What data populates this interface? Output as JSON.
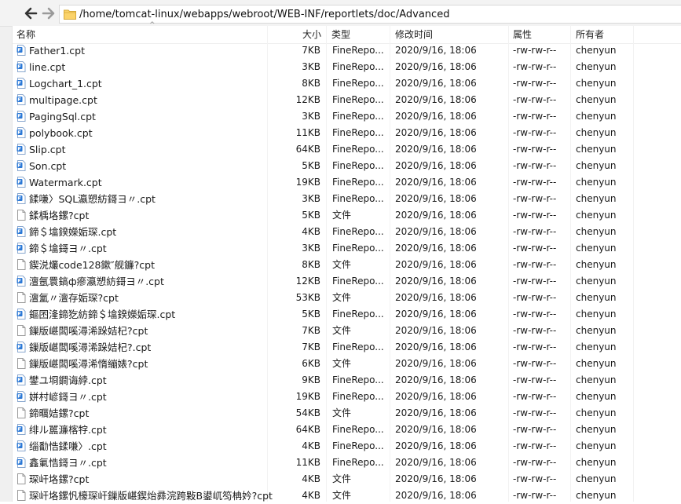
{
  "path": "/home/tomcat-linux/webapps/webroot/WEB-INF/reportlets/doc/Advanced",
  "columns": {
    "name": "名称",
    "size": "大小",
    "type": "类型",
    "mtime": "修改时间",
    "perm": "属性",
    "owner": "所有者"
  },
  "sort_indicator": "^",
  "files": [
    {
      "name": "Father1.cpt",
      "size": "7KB",
      "type": "FineRepo...",
      "mtime": "2020/9/16, 18:06",
      "perm": "-rw-rw-r--",
      "owner": "chenyun",
      "icon": "finereport-file-icon"
    },
    {
      "name": "line.cpt",
      "size": "3KB",
      "type": "FineRepo...",
      "mtime": "2020/9/16, 18:06",
      "perm": "-rw-rw-r--",
      "owner": "chenyun",
      "icon": "finereport-file-icon"
    },
    {
      "name": "Logchart_1.cpt",
      "size": "8KB",
      "type": "FineRepo...",
      "mtime": "2020/9/16, 18:06",
      "perm": "-rw-rw-r--",
      "owner": "chenyun",
      "icon": "finereport-file-icon"
    },
    {
      "name": "multipage.cpt",
      "size": "12KB",
      "type": "FineRepo...",
      "mtime": "2020/9/16, 18:06",
      "perm": "-rw-rw-r--",
      "owner": "chenyun",
      "icon": "finereport-file-icon"
    },
    {
      "name": "PagingSql.cpt",
      "size": "3KB",
      "type": "FineRepo...",
      "mtime": "2020/9/16, 18:06",
      "perm": "-rw-rw-r--",
      "owner": "chenyun",
      "icon": "finereport-file-icon"
    },
    {
      "name": "polybook.cpt",
      "size": "11KB",
      "type": "FineRepo...",
      "mtime": "2020/9/16, 18:06",
      "perm": "-rw-rw-r--",
      "owner": "chenyun",
      "icon": "finereport-file-icon"
    },
    {
      "name": "Slip.cpt",
      "size": "64KB",
      "type": "FineRepo...",
      "mtime": "2020/9/16, 18:06",
      "perm": "-rw-rw-r--",
      "owner": "chenyun",
      "icon": "finereport-file-icon"
    },
    {
      "name": "Son.cpt",
      "size": "5KB",
      "type": "FineRepo...",
      "mtime": "2020/9/16, 18:06",
      "perm": "-rw-rw-r--",
      "owner": "chenyun",
      "icon": "finereport-file-icon"
    },
    {
      "name": "Watermark.cpt",
      "size": "19KB",
      "type": "FineRepo...",
      "mtime": "2020/9/16, 18:06",
      "perm": "-rw-rw-r--",
      "owner": "chenyun",
      "icon": "finereport-file-icon"
    },
    {
      "name": "鍒嗛〉SQL瀛愬紡鎶ヨ〃.cpt",
      "size": "3KB",
      "type": "FineRepo...",
      "mtime": "2020/9/16, 18:06",
      "perm": "-rw-rw-r--",
      "owner": "chenyun",
      "icon": "finereport-file-icon"
    },
    {
      "name": "鍒楀垎鏍?cpt",
      "size": "5KB",
      "type": "文件",
      "mtime": "2020/9/16, 18:06",
      "perm": "-rw-rw-r--",
      "owner": "chenyun",
      "icon": "generic-file-icon"
    },
    {
      "name": "鍗＄墖鍨嬫姤琛.cpt",
      "size": "4KB",
      "type": "FineRepo...",
      "mtime": "2020/9/16, 18:06",
      "perm": "-rw-rw-r--",
      "owner": "chenyun",
      "icon": "finereport-file-icon"
    },
    {
      "name": "鍗＄墖鎶ヨ〃.cpt",
      "size": "3KB",
      "type": "FineRepo...",
      "mtime": "2020/9/16, 18:06",
      "perm": "-rw-rw-r--",
      "owner": "chenyun",
      "icon": "finereport-file-icon"
    },
    {
      "name": "鍥涚爜code128鏉″舰鐮?cpt",
      "size": "8KB",
      "type": "文件",
      "mtime": "2020/9/16, 18:06",
      "perm": "-rw-rw-r--",
      "owner": "chenyun",
      "icon": "generic-file-icon"
    },
    {
      "name": "澶氬睘鎬ф瘮瀛愬紡鎶ヨ〃.cpt",
      "size": "12KB",
      "type": "FineRepo...",
      "mtime": "2020/9/16, 18:06",
      "perm": "-rw-rw-r--",
      "owner": "chenyun",
      "icon": "finereport-file-icon"
    },
    {
      "name": "澶氳〃澶存姤琛?cpt",
      "size": "53KB",
      "type": "文件",
      "mtime": "2020/9/16, 18:06",
      "perm": "-rw-rw-r--",
      "owner": "chenyun",
      "icon": "generic-file-icon"
    },
    {
      "name": "鏂囨湰鍗犵紡鍗＄墖鍨嬫姤琛.cpt",
      "size": "5KB",
      "type": "FineRepo...",
      "mtime": "2020/9/16, 18:06",
      "perm": "-rw-rw-r--",
      "owner": "chenyun",
      "icon": "finereport-file-icon"
    },
    {
      "name": "鏁版嵁闆嗘潯浠跺姞杞?cpt",
      "size": "7KB",
      "type": "文件",
      "mtime": "2020/9/16, 18:06",
      "perm": "-rw-rw-r--",
      "owner": "chenyun",
      "icon": "generic-file-icon"
    },
    {
      "name": "鏁版嵁闆嗘潯浠跺姞杞?.cpt",
      "size": "7KB",
      "type": "FineRepo...",
      "mtime": "2020/9/16, 18:06",
      "perm": "-rw-rw-r--",
      "owner": "chenyun",
      "icon": "finereport-file-icon"
    },
    {
      "name": "鏁版嵁闆嗘潯浠惰繃婊?cpt",
      "size": "6KB",
      "type": "文件",
      "mtime": "2020/9/16, 18:06",
      "perm": "-rw-rw-r--",
      "owner": "chenyun",
      "icon": "generic-file-icon"
    },
    {
      "name": "鐢ユ埛鐧诲綍.cpt",
      "size": "9KB",
      "type": "FineRepo...",
      "mtime": "2020/9/16, 18:06",
      "perm": "-rw-rw-r--",
      "owner": "chenyun",
      "icon": "finereport-file-icon"
    },
    {
      "name": "姘村嵃鎶ヨ〃.cpt",
      "size": "19KB",
      "type": "FineRepo...",
      "mtime": "2020/9/16, 18:06",
      "perm": "-rw-rw-r--",
      "owner": "chenyun",
      "icon": "finereport-file-icon"
    },
    {
      "name": "鍗曞姞鏍?cpt",
      "size": "54KB",
      "type": "文件",
      "mtime": "2020/9/16, 18:06",
      "perm": "-rw-rw-r--",
      "owner": "chenyun",
      "icon": "generic-file-icon"
    },
    {
      "name": "绯ル嚚濂楁牸.cpt",
      "size": "64KB",
      "type": "FineRepo...",
      "mtime": "2020/9/16, 18:06",
      "perm": "-rw-rw-r--",
      "owner": "chenyun",
      "icon": "finereport-file-icon"
    },
    {
      "name": "缁勫悎鍒嗛〉.cpt",
      "size": "4KB",
      "type": "FineRepo...",
      "mtime": "2020/9/16, 18:06",
      "perm": "-rw-rw-r--",
      "owner": "chenyun",
      "icon": "finereport-file-icon"
    },
    {
      "name": "鑫氭悎鎶ヨ〃.cpt",
      "size": "11KB",
      "type": "FineRepo...",
      "mtime": "2020/9/16, 18:06",
      "perm": "-rw-rw-r--",
      "owner": "chenyun",
      "icon": "finereport-file-icon"
    },
    {
      "name": "琛屽垎鏍?cpt",
      "size": "4KB",
      "type": "文件",
      "mtime": "2020/9/16, 18:06",
      "perm": "-rw-rw-r--",
      "owner": "chenyun",
      "icon": "generic-file-icon"
    },
    {
      "name": "琛屽垎鏍忛檺琛屽鏁版嵁鍥炲彞浣跨敤B鍙屼笉柟妗?cpt",
      "size": "4KB",
      "type": "文件",
      "mtime": "2020/9/16, 18:06",
      "perm": "-rw-rw-r--",
      "owner": "chenyun",
      "icon": "generic-file-icon"
    }
  ],
  "colors": {
    "accent": "#1e6fd9",
    "folder": "#f2c14e"
  }
}
